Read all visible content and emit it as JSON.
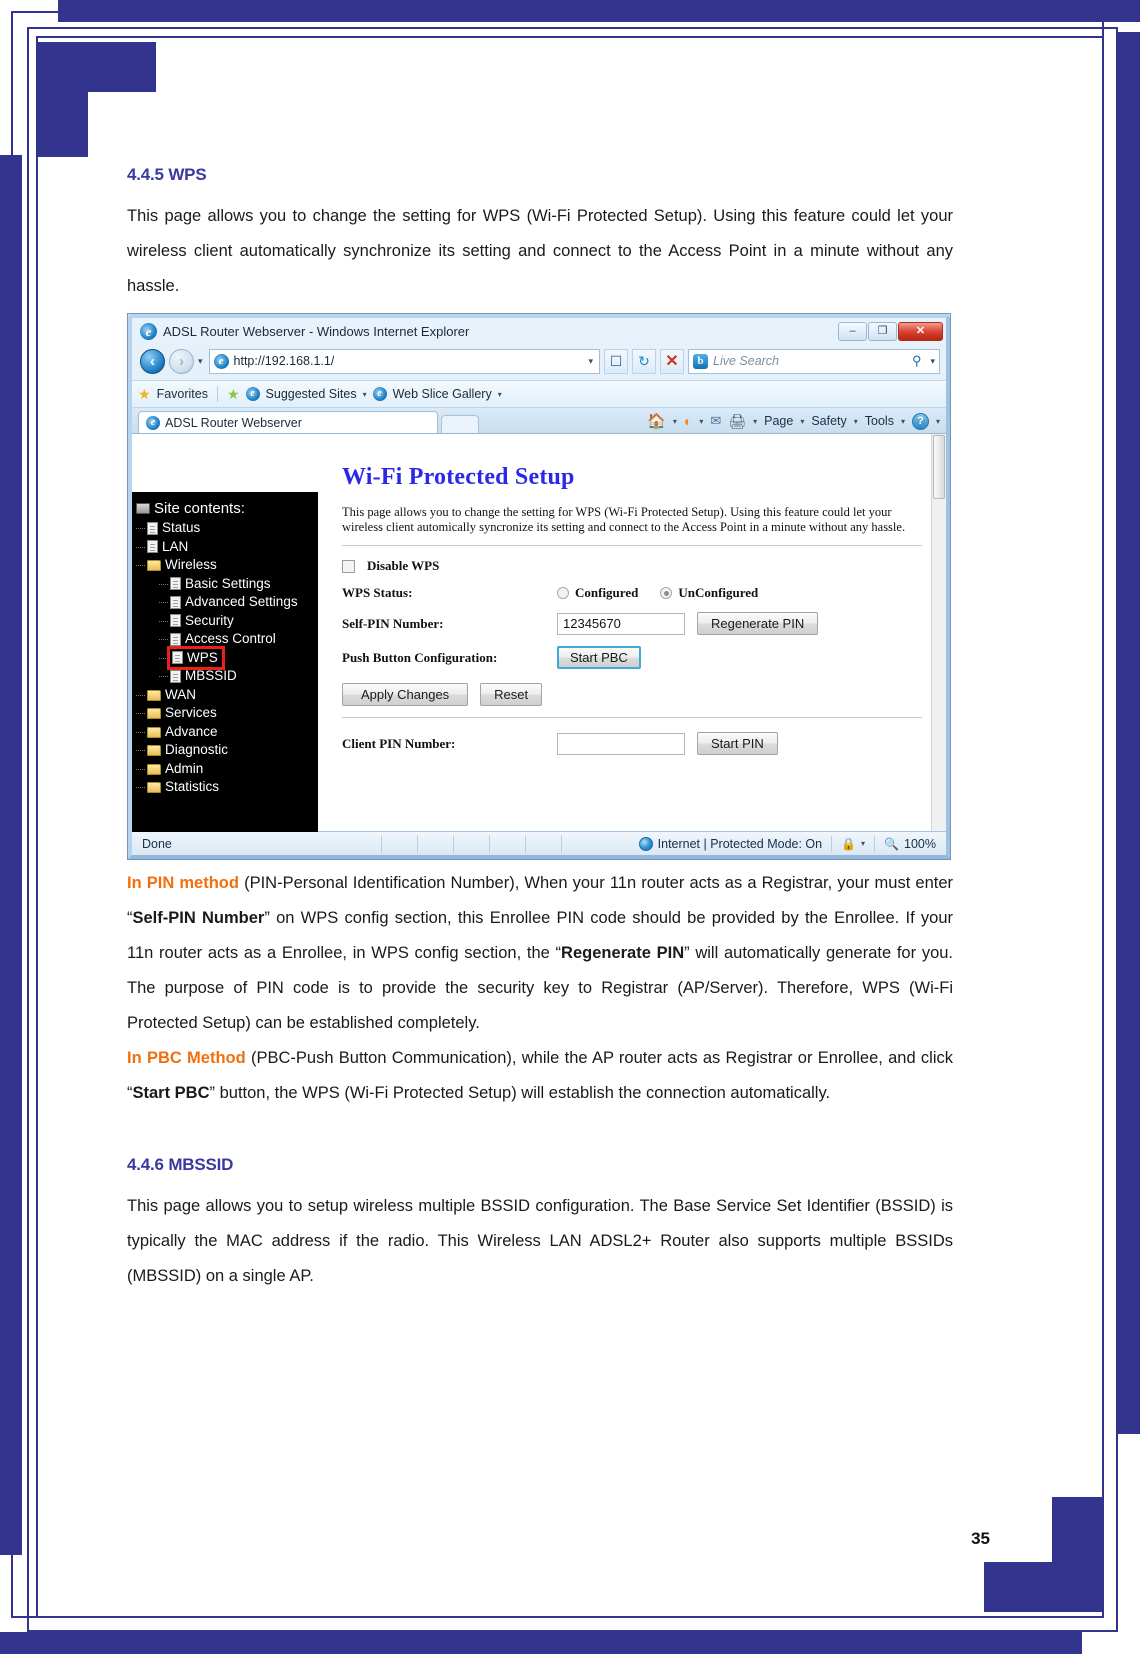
{
  "document": {
    "page_number": "35",
    "heading_color": "#3b39a0",
    "accent_orange": "#f07010",
    "section_wps": {
      "heading": "4.4.5 WPS",
      "intro": "This page allows you to change the setting for WPS (Wi-Fi Protected Setup). Using this feature could let your wireless client automatically synchronize its setting and connect to the Access Point in a minute without any hassle."
    },
    "pin_paragraph": {
      "lead": "In PIN method",
      "part1": " (PIN-Personal Identification Number), When your 11n router acts as a Registrar, your must enter “",
      "bold1": "Self-PIN Number",
      "part2": "” on WPS config section, this Enrollee PIN code should be provided by the Enrollee. If your 11n router acts as a Enrollee, in WPS config section, the “",
      "bold2": "Regenerate PIN",
      "part3": "” will automatically generate for you. The purpose of PIN code is to provide the security key to Registrar (AP/Server). Therefore, WPS (Wi-Fi Protected Setup) can be established completely."
    },
    "pbc_paragraph": {
      "lead": "In PBC Method",
      "part1": " (PBC-Push Button Communication), while the AP router acts as Registrar or Enrollee, and click “",
      "bold1": "Start PBC",
      "part2": "” button, the WPS (Wi-Fi Protected Setup) will establish the connection automatically."
    },
    "section_mbssid": {
      "heading": "4.4.6 MBSSID",
      "intro": "This page allows you to setup wireless multiple BSSID configuration. The Base Service Set Identifier (BSSID) is typically the MAC address if the radio. This Wireless LAN ADSL2+ Router also supports multiple BSSIDs (MBSSID) on a single AP."
    }
  },
  "browser": {
    "title": "ADSL Router Webserver - Windows Internet Explorer",
    "window_buttons": {
      "minimize": "–",
      "maximize": "❐",
      "close": "✕"
    },
    "address": {
      "url": "http://192.168.1.1/",
      "dropdown_caret": "▾",
      "compat_icon": "compatibility-view-icon",
      "refresh_icon": "↻",
      "stop_icon": "✕"
    },
    "search": {
      "placeholder": "Live Search",
      "brand": "b",
      "magnifier": "⚲",
      "caret": "▾"
    },
    "favorites_bar": {
      "favorites": "Favorites",
      "suggested_sites": "Suggested Sites",
      "web_slice_gallery": "Web Slice Gallery",
      "caret": "▾"
    },
    "tab": {
      "label": "ADSL Router Webserver"
    },
    "command_bar": {
      "page": "Page",
      "safety": "Safety",
      "tools": "Tools",
      "help": "?",
      "caret": "▾"
    },
    "status_bar": {
      "status": "Done",
      "zone": "Internet | Protected Mode: On",
      "zoom": "100%",
      "caret": "▾"
    }
  },
  "router_page": {
    "sidebar": {
      "root_label": "Site contents:",
      "items": [
        {
          "label": "Status",
          "icon": "page-icon",
          "level": 1
        },
        {
          "label": "LAN",
          "icon": "page-icon",
          "level": 1
        },
        {
          "label": "Wireless",
          "icon": "folder-open-icon",
          "level": 1
        },
        {
          "label": "Basic Settings",
          "icon": "page-icon",
          "level": 2
        },
        {
          "label": "Advanced Settings",
          "icon": "page-icon",
          "level": 2
        },
        {
          "label": "Security",
          "icon": "page-icon",
          "level": 2
        },
        {
          "label": "Access Control",
          "icon": "page-icon",
          "level": 2
        },
        {
          "label": "WPS",
          "icon": "page-icon",
          "level": 2,
          "highlight": true
        },
        {
          "label": "MBSSID",
          "icon": "page-icon",
          "level": 2
        },
        {
          "label": "WAN",
          "icon": "folder-icon",
          "level": 1
        },
        {
          "label": "Services",
          "icon": "folder-icon",
          "level": 1
        },
        {
          "label": "Advance",
          "icon": "folder-icon",
          "level": 1
        },
        {
          "label": "Diagnostic",
          "icon": "folder-icon",
          "level": 1
        },
        {
          "label": "Admin",
          "icon": "folder-icon",
          "level": 1
        },
        {
          "label": "Statistics",
          "icon": "folder-icon",
          "level": 1
        }
      ],
      "highlight_color": "#e8211a"
    },
    "title": "Wi-Fi Protected Setup",
    "title_color": "#2b28e8",
    "description": "This page allows you to change the setting for WPS (Wi-Fi Protected Setup). Using this feature could let your wireless client automically syncronize its setting and connect to the Access Point in a minute without any hassle.",
    "form": {
      "disable_wps_label": "Disable WPS",
      "disable_wps_checked": false,
      "wps_status_label": "WPS Status:",
      "status_option_configured": "Configured",
      "status_option_unconfigured": "UnConfigured",
      "status_selected": "UnConfigured",
      "self_pin_label": "Self-PIN Number:",
      "self_pin_value": "12345670",
      "regenerate_pin_button": "Regenerate PIN",
      "push_button_label": "Push Button Configuration:",
      "start_pbc_button": "Start PBC",
      "apply_changes_button": "Apply Changes",
      "reset_button": "Reset",
      "client_pin_label": "Client PIN Number:",
      "client_pin_value": "",
      "start_pin_button": "Start PIN"
    }
  }
}
